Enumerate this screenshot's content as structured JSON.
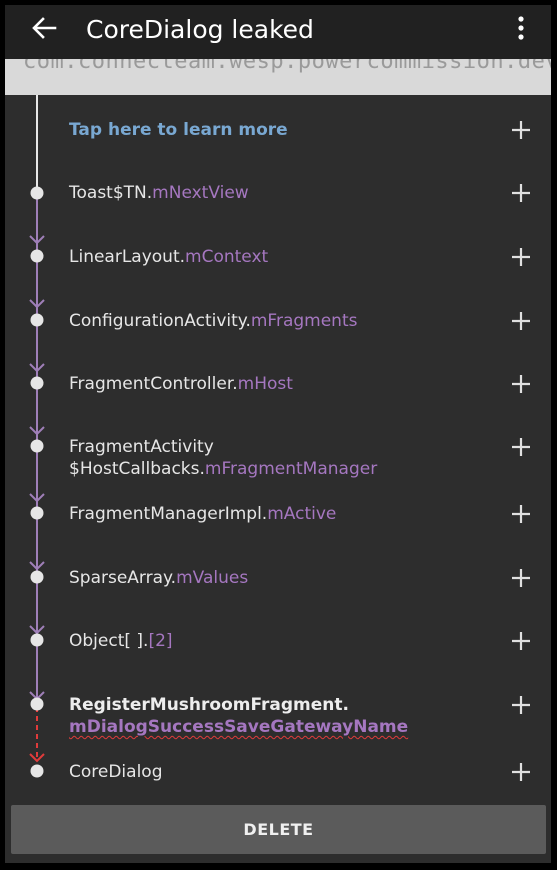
{
  "app_bar": {
    "title": "CoreDialog leaked",
    "back_icon": "arrow-left-icon",
    "menu_icon": "more-vert-icon"
  },
  "peek": {
    "text": "com.connecteam.wesp.powercommission.dev"
  },
  "learn_more": "Tap here to learn more",
  "rows": [
    {
      "class": "Toast$TN.",
      "field": "mNextView"
    },
    {
      "class": "LinearLayout.",
      "field": "mContext"
    },
    {
      "class": "ConfigurationActivity.",
      "field": "mFragments"
    },
    {
      "class": "FragmentController.",
      "field": "mHost"
    },
    {
      "class_line1": "FragmentActivity",
      "class_line2": "$HostCallbacks.",
      "field": "mFragmentManager"
    },
    {
      "class": "FragmentManagerImpl.",
      "field": "mActive"
    },
    {
      "class": "SparseArray.",
      "field": "mValues"
    },
    {
      "class": "Object[ ].",
      "field": "[2]"
    },
    {
      "class": "RegisterMushroomFragment.",
      "field": "mDialogSuccessSaveGatewayName"
    },
    {
      "class": "CoreDialog"
    }
  ],
  "delete_label": "DELETE",
  "colors": {
    "background": "#2d2d2d",
    "app_bar": "#212121",
    "link": "#79a8d2",
    "field": "#a577c0",
    "leak_arrow": "#e03b3b",
    "line": "#9f7fb8"
  }
}
